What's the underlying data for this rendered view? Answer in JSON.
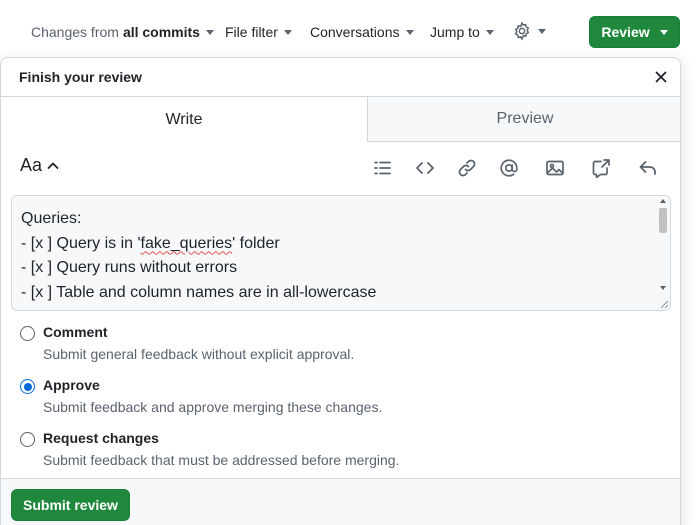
{
  "toolbar": {
    "changes_prefix": "Changes from",
    "changes_value": "all commits",
    "file_filter": "File filter",
    "conversations": "Conversations",
    "jump_to": "Jump to",
    "settings_icon": "gear-icon",
    "review_label": "Review"
  },
  "dialog": {
    "title": "Finish your review",
    "close_icon": "x-icon",
    "tabs": [
      {
        "label": "Write",
        "selected": true
      },
      {
        "label": "Preview",
        "selected": false
      }
    ],
    "formatting": {
      "heading_label": "Aa",
      "icons": [
        "list-icon",
        "code-icon",
        "link-icon",
        "mention-icon",
        "image-icon",
        "cross-reference-icon",
        "reply-icon"
      ]
    },
    "editor": {
      "line1": "Queries:",
      "line2_prefix": "- [x ] Query is in '",
      "line2_misspelled": "fake_queries",
      "line2_suffix": "' folder",
      "line3": "- [x ] Query runs without errors",
      "line4": "- [x ] Table and column names are in all-lowercase"
    },
    "options": [
      {
        "label": "Comment",
        "description": "Submit general feedback without explicit approval.",
        "checked": false
      },
      {
        "label": "Approve",
        "description": "Submit feedback and approve merging these changes.",
        "checked": true
      },
      {
        "label": "Request changes",
        "description": "Submit feedback that must be addressed before merging.",
        "checked": false
      }
    ],
    "submit_label": "Submit review"
  },
  "colors": {
    "primary_green": "#1f883d",
    "radio_blue": "#0969da",
    "muted_text": "#59636e",
    "border": "#d1d9e0"
  }
}
